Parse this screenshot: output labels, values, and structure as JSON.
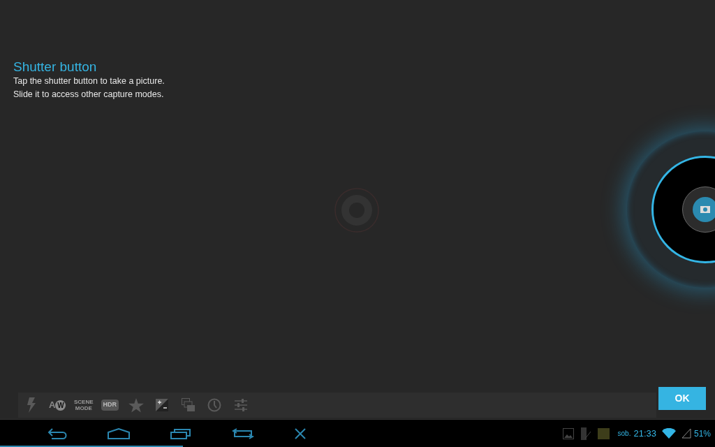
{
  "tip": {
    "title": "Shutter button",
    "lines": [
      "Tap the shutter button to take a picture.",
      "Slide it to access other capture modes."
    ]
  },
  "toolbar": [
    {
      "kind": "flash"
    },
    {
      "kind": "white-balance",
      "prefix": "A",
      "badge": "W"
    },
    {
      "kind": "stacked-text",
      "lines": [
        "SCENE",
        "MODE"
      ]
    },
    {
      "kind": "boxed-text",
      "label": "HDR"
    },
    {
      "kind": "star"
    },
    {
      "kind": "exposure"
    },
    {
      "kind": "stack"
    },
    {
      "kind": "timer"
    },
    {
      "kind": "sliders"
    }
  ],
  "ok_button": "OK",
  "nav": [
    {
      "kind": "back"
    },
    {
      "kind": "home"
    },
    {
      "kind": "recents"
    },
    {
      "kind": "rotate"
    },
    {
      "kind": "close"
    }
  ],
  "status": {
    "day": "sob.",
    "time": "21:33",
    "battery": "51%"
  }
}
